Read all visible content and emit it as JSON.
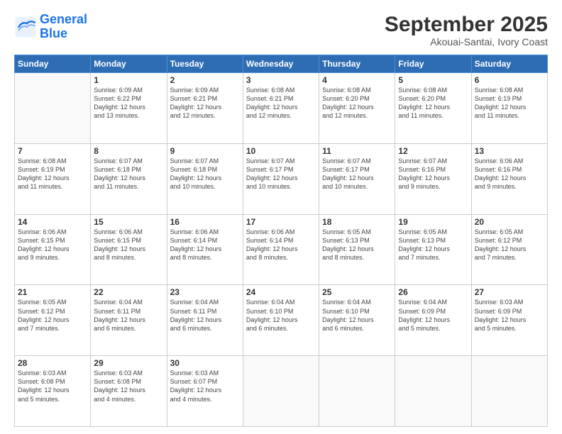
{
  "logo": {
    "line1": "General",
    "line2": "Blue"
  },
  "title": "September 2025",
  "subtitle": "Akouai-Santai, Ivory Coast",
  "weekdays": [
    "Sunday",
    "Monday",
    "Tuesday",
    "Wednesday",
    "Thursday",
    "Friday",
    "Saturday"
  ],
  "weeks": [
    [
      {
        "day": "",
        "info": ""
      },
      {
        "day": "1",
        "info": "Sunrise: 6:09 AM\nSunset: 6:22 PM\nDaylight: 12 hours\nand 13 minutes."
      },
      {
        "day": "2",
        "info": "Sunrise: 6:09 AM\nSunset: 6:21 PM\nDaylight: 12 hours\nand 12 minutes."
      },
      {
        "day": "3",
        "info": "Sunrise: 6:08 AM\nSunset: 6:21 PM\nDaylight: 12 hours\nand 12 minutes."
      },
      {
        "day": "4",
        "info": "Sunrise: 6:08 AM\nSunset: 6:20 PM\nDaylight: 12 hours\nand 12 minutes."
      },
      {
        "day": "5",
        "info": "Sunrise: 6:08 AM\nSunset: 6:20 PM\nDaylight: 12 hours\nand 11 minutes."
      },
      {
        "day": "6",
        "info": "Sunrise: 6:08 AM\nSunset: 6:19 PM\nDaylight: 12 hours\nand 11 minutes."
      }
    ],
    [
      {
        "day": "7",
        "info": "Sunrise: 6:08 AM\nSunset: 6:19 PM\nDaylight: 12 hours\nand 11 minutes."
      },
      {
        "day": "8",
        "info": "Sunrise: 6:07 AM\nSunset: 6:18 PM\nDaylight: 12 hours\nand 11 minutes."
      },
      {
        "day": "9",
        "info": "Sunrise: 6:07 AM\nSunset: 6:18 PM\nDaylight: 12 hours\nand 10 minutes."
      },
      {
        "day": "10",
        "info": "Sunrise: 6:07 AM\nSunset: 6:17 PM\nDaylight: 12 hours\nand 10 minutes."
      },
      {
        "day": "11",
        "info": "Sunrise: 6:07 AM\nSunset: 6:17 PM\nDaylight: 12 hours\nand 10 minutes."
      },
      {
        "day": "12",
        "info": "Sunrise: 6:07 AM\nSunset: 6:16 PM\nDaylight: 12 hours\nand 9 minutes."
      },
      {
        "day": "13",
        "info": "Sunrise: 6:06 AM\nSunset: 6:16 PM\nDaylight: 12 hours\nand 9 minutes."
      }
    ],
    [
      {
        "day": "14",
        "info": "Sunrise: 6:06 AM\nSunset: 6:15 PM\nDaylight: 12 hours\nand 9 minutes."
      },
      {
        "day": "15",
        "info": "Sunrise: 6:06 AM\nSunset: 6:15 PM\nDaylight: 12 hours\nand 8 minutes."
      },
      {
        "day": "16",
        "info": "Sunrise: 6:06 AM\nSunset: 6:14 PM\nDaylight: 12 hours\nand 8 minutes."
      },
      {
        "day": "17",
        "info": "Sunrise: 6:06 AM\nSunset: 6:14 PM\nDaylight: 12 hours\nand 8 minutes."
      },
      {
        "day": "18",
        "info": "Sunrise: 6:05 AM\nSunset: 6:13 PM\nDaylight: 12 hours\nand 8 minutes."
      },
      {
        "day": "19",
        "info": "Sunrise: 6:05 AM\nSunset: 6:13 PM\nDaylight: 12 hours\nand 7 minutes."
      },
      {
        "day": "20",
        "info": "Sunrise: 6:05 AM\nSunset: 6:12 PM\nDaylight: 12 hours\nand 7 minutes."
      }
    ],
    [
      {
        "day": "21",
        "info": "Sunrise: 6:05 AM\nSunset: 6:12 PM\nDaylight: 12 hours\nand 7 minutes."
      },
      {
        "day": "22",
        "info": "Sunrise: 6:04 AM\nSunset: 6:11 PM\nDaylight: 12 hours\nand 6 minutes."
      },
      {
        "day": "23",
        "info": "Sunrise: 6:04 AM\nSunset: 6:11 PM\nDaylight: 12 hours\nand 6 minutes."
      },
      {
        "day": "24",
        "info": "Sunrise: 6:04 AM\nSunset: 6:10 PM\nDaylight: 12 hours\nand 6 minutes."
      },
      {
        "day": "25",
        "info": "Sunrise: 6:04 AM\nSunset: 6:10 PM\nDaylight: 12 hours\nand 6 minutes."
      },
      {
        "day": "26",
        "info": "Sunrise: 6:04 AM\nSunset: 6:09 PM\nDaylight: 12 hours\nand 5 minutes."
      },
      {
        "day": "27",
        "info": "Sunrise: 6:03 AM\nSunset: 6:09 PM\nDaylight: 12 hours\nand 5 minutes."
      }
    ],
    [
      {
        "day": "28",
        "info": "Sunrise: 6:03 AM\nSunset: 6:08 PM\nDaylight: 12 hours\nand 5 minutes."
      },
      {
        "day": "29",
        "info": "Sunrise: 6:03 AM\nSunset: 6:08 PM\nDaylight: 12 hours\nand 4 minutes."
      },
      {
        "day": "30",
        "info": "Sunrise: 6:03 AM\nSunset: 6:07 PM\nDaylight: 12 hours\nand 4 minutes."
      },
      {
        "day": "",
        "info": ""
      },
      {
        "day": "",
        "info": ""
      },
      {
        "day": "",
        "info": ""
      },
      {
        "day": "",
        "info": ""
      }
    ]
  ]
}
